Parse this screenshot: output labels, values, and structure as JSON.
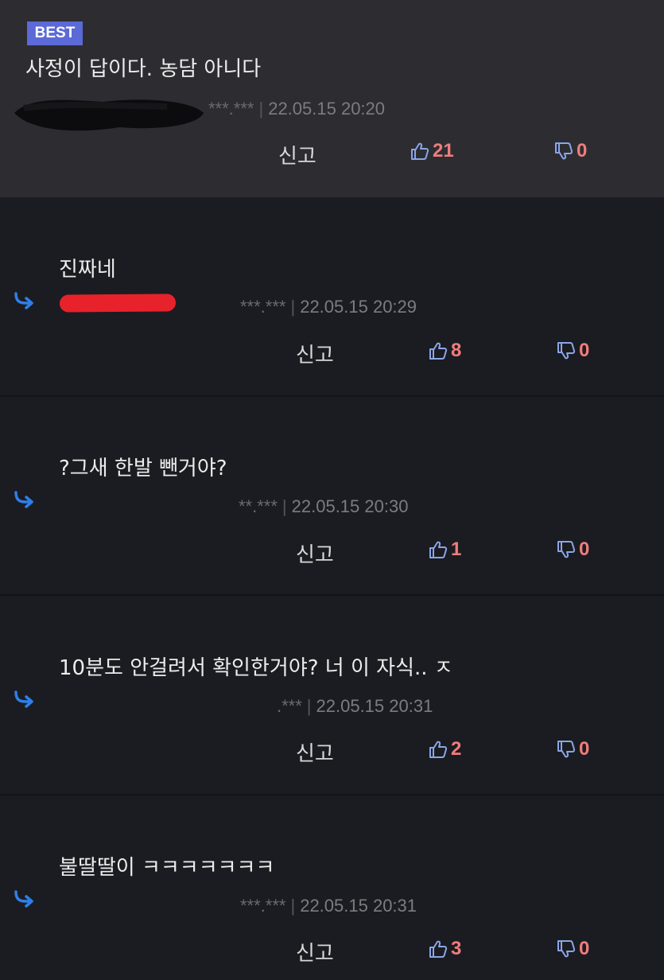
{
  "best_badge": "BEST",
  "report_label": "신고",
  "colors": {
    "background": "#1b1c21",
    "best_background": "#2d2d31",
    "badge": "#5b6ad6",
    "count": "#ef7d7d",
    "icon": "#8aa6e8",
    "reply_arrow": "#2f7fe8",
    "redaction_red": "#e8222a"
  },
  "icons": {
    "like": "thumbs-up-icon",
    "dislike": "thumbs-down-icon",
    "reply": "reply-arrow-icon"
  },
  "comments": [
    {
      "text": "사정이 답이다. 농담 아니다",
      "author_masked": "***.***",
      "timestamp": "22.05.15 20:20",
      "likes": "21",
      "dislikes": "0",
      "is_best": true
    },
    {
      "text": "진짜네",
      "author_masked": "***.***",
      "timestamp": "22.05.15 20:29",
      "likes": "8",
      "dislikes": "0"
    },
    {
      "text": "?그새 한발 뺀거야?",
      "author_masked": "**.***",
      "timestamp": "22.05.15 20:30",
      "likes": "1",
      "dislikes": "0"
    },
    {
      "text": "10분도 안걸려서 확인한거야? 너 이 자식.. ㅈ",
      "author_masked": ".***",
      "timestamp": "22.05.15 20:31",
      "likes": "2",
      "dislikes": "0"
    },
    {
      "text": "불딸딸이 ㅋㅋㅋㅋㅋㅋㅋ",
      "author_masked": "***.***",
      "timestamp": "22.05.15 20:31",
      "likes": "3",
      "dislikes": "0"
    }
  ]
}
